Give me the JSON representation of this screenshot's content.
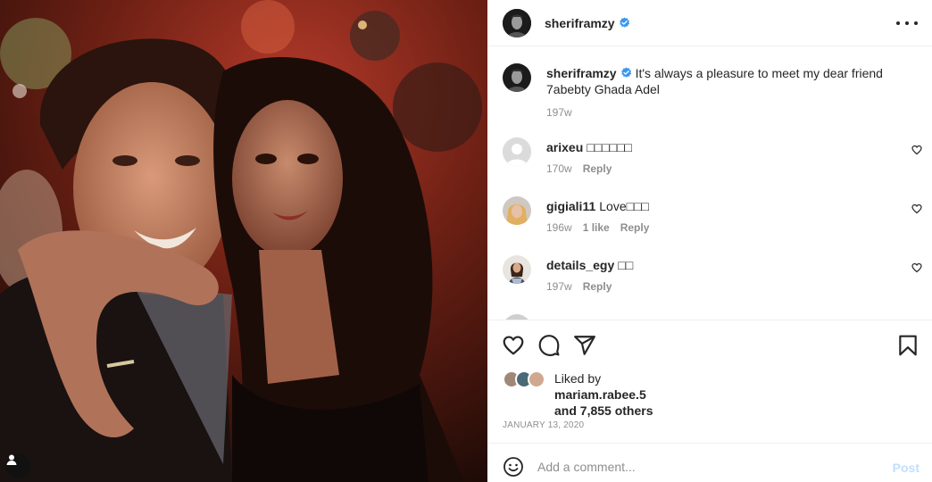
{
  "post": {
    "username": "sheriframzy",
    "verified": true,
    "caption": "It's always a pleasure to meet my dear friend 7abebty Ghada Adel",
    "caption_age": "197w"
  },
  "comments": [
    {
      "username": "arixeu",
      "text": "□□□□□□",
      "age": "170w",
      "likes": "",
      "reply": "Reply"
    },
    {
      "username": "gigiali11",
      "text": "Love□□□",
      "age": "196w",
      "likes": "1 like",
      "reply": "Reply"
    },
    {
      "username": "details_egy",
      "text": "□□",
      "age": "197w",
      "likes": "",
      "reply": "Reply"
    }
  ],
  "likes": {
    "prefix": "Liked by",
    "user": "mariam.rabee.5",
    "others": "and 7,855 others"
  },
  "date": "JANUARY 13, 2020",
  "add_comment": {
    "placeholder": "Add a comment...",
    "post_label": "Post"
  },
  "colors": {
    "verified": "#3897f0",
    "post_disabled": "#c0dffd",
    "muted": "#8e8e8e"
  },
  "icons": [
    "heart-icon",
    "comment-icon",
    "share-icon",
    "bookmark-icon",
    "emoji-icon",
    "more-icon",
    "user-tag-icon",
    "verified-badge-icon"
  ]
}
